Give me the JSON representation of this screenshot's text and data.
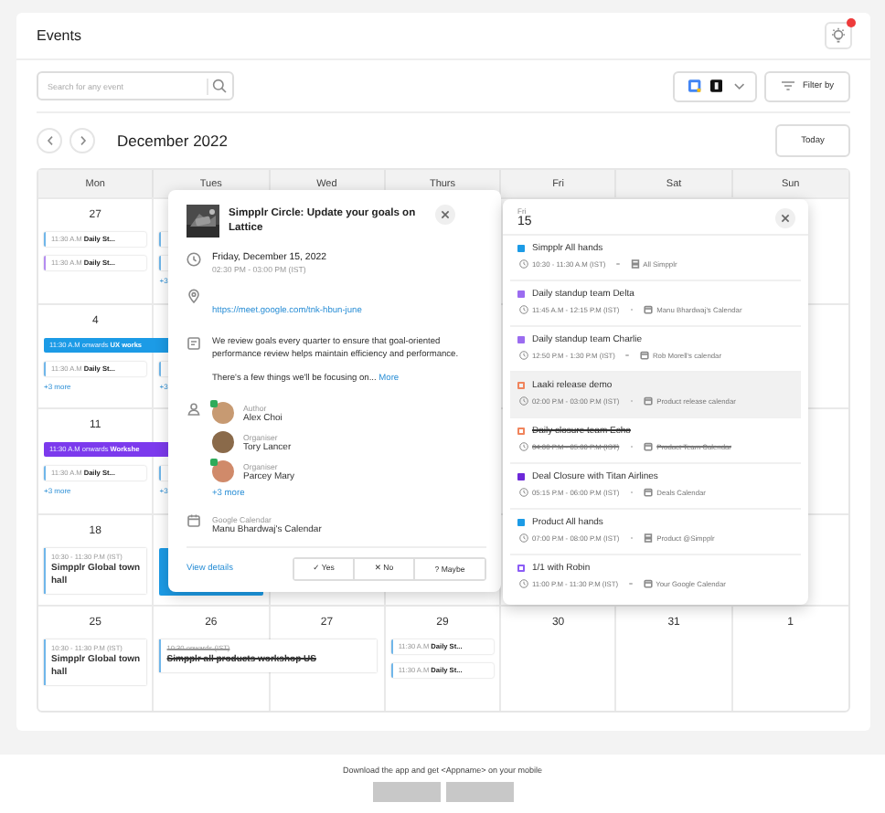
{
  "header": {
    "title": "Events",
    "notification": true
  },
  "search": {
    "placeholder": "Search for any event"
  },
  "calendar_toggle": {
    "sources": [
      {
        "kind": "google"
      },
      {
        "kind": "dark"
      }
    ]
  },
  "filter": {
    "label": "Filter by"
  },
  "nav": {
    "month": "December 2022",
    "today": "Today"
  },
  "weekdays": [
    "Mon",
    "Tues",
    "Wed",
    "Thurs",
    "Fri",
    "Sat",
    "Sun"
  ],
  "weeks": [
    {
      "cells": [
        {
          "date": "27",
          "events": [
            {
              "kind": "line",
              "time": "11:30 A.M",
              "title": "Daily St...",
              "color": "#6fb6ea"
            },
            {
              "kind": "line",
              "time": "11:30 A.M",
              "title": "Daily St...",
              "color": "#b48cf0"
            }
          ]
        },
        {
          "events": [
            {
              "kind": "stub",
              "color": "#6fb6ea"
            },
            {
              "kind": "stub",
              "color": "#6fb6ea"
            }
          ],
          "more": "+3"
        },
        {},
        {},
        {},
        {},
        {}
      ]
    },
    {
      "cells": [
        {
          "date": "4",
          "events": [
            {
              "kind": "banner",
              "time": "11:30 A.M onwards",
              "title": "UX works",
              "color": "#1c9be6"
            },
            {
              "kind": "line",
              "time": "11:30 A.M",
              "title": "Daily St...",
              "color": "#6fb6ea"
            }
          ],
          "more": "+3 more"
        },
        {
          "events": [
            {
              "kind": "stub",
              "color": "#6fb6ea"
            }
          ],
          "more": "+3"
        },
        {},
        {},
        {},
        {},
        {}
      ]
    },
    {
      "cells": [
        {
          "date": "11",
          "events": [
            {
              "kind": "banner",
              "time": "11:30 A.M onwards",
              "title": "Workshe",
              "color": "#7c3aed"
            },
            {
              "kind": "line",
              "time": "11:30 A.M",
              "title": "Daily St...",
              "color": "#6fb6ea"
            }
          ],
          "more": "+3 more"
        },
        {
          "events": [
            {
              "kind": "stub",
              "color": "#6fb6ea"
            }
          ],
          "more": "+3"
        },
        {},
        {},
        {},
        {},
        {}
      ]
    },
    {
      "cells": [
        {
          "date": "18",
          "events": [
            {
              "kind": "block",
              "time": "10:30 - 11:30 P.M (IST)",
              "title": "Simpplr Global town hall",
              "color": "#6fb6ea",
              "cancelled": false
            }
          ]
        },
        {
          "events": [
            {
              "kind": "fill",
              "color": "#1c9be6"
            }
          ]
        },
        {},
        {},
        {},
        {},
        {}
      ]
    },
    {
      "cells": [
        {
          "date": "25",
          "events": [
            {
              "kind": "block",
              "time": "10:30 - 11:30 P.M (IST)",
              "title": "Simpplr Global town hall",
              "color": "#6fb6ea",
              "cancelled": false
            }
          ]
        },
        {
          "date": "26",
          "events": [
            {
              "kind": "wide_block",
              "time": "10:30 onwards (IST)",
              "title": "Simpplr all products workshop US",
              "color": "#6fb6ea",
              "cancelled": true
            }
          ]
        },
        {
          "date": "27"
        },
        {
          "date": "29",
          "events": [
            {
              "kind": "line",
              "time": "11:30 A.M",
              "title": "Daily St...",
              "color": "#6fb6ea"
            },
            {
              "kind": "line",
              "time": "11:30 A.M",
              "title": "Daily St...",
              "color": "#6fb6ea"
            }
          ]
        },
        {
          "date": "30"
        },
        {
          "date": "31"
        },
        {
          "date": "1"
        }
      ]
    }
  ],
  "event_popover": {
    "title": "Simpplr Circle: Update your goals on Lattice",
    "date": "Friday, December 15, 2022",
    "time": "02:30 PM - 03:00 PM (IST)",
    "link": "https://meet.google.com/tnk-hbun-june",
    "description": "We review goals every quarter to ensure that goal-oriented performance review helps maintain efficiency and performance.",
    "teaser": "There's a few things we'll be focusing on...",
    "more": "More",
    "people": [
      {
        "role": "Author",
        "name": "Alex Choi",
        "badge": true
      },
      {
        "role": "Organiser",
        "name": "Tory Lancer",
        "badge": false
      },
      {
        "role": "Organiser",
        "name": "Parcey Mary",
        "badge": true
      }
    ],
    "people_more": "+3 more",
    "calendar_source": "Google Calendar",
    "calendar": "Manu Bhardwaj's Calendar",
    "details": "View details",
    "rsvp": [
      {
        "label": "✓ Yes",
        "selected": false
      },
      {
        "label": "✕ No",
        "selected": false
      },
      {
        "label": "? Maybe",
        "selected": false
      }
    ]
  },
  "day_popover": {
    "weekday": "Fri",
    "date": "15",
    "events": [
      {
        "title": "Simpplr All hands",
        "time": "10:30 - 11:30 A.M (IST)",
        "calendar": "All Simpplr",
        "kind": "group",
        "color": "#1c9be6",
        "filled": true,
        "selected": false,
        "cancelled": false
      },
      {
        "title": "Daily standup team Delta",
        "time": "11:45 A.M - 12:15 P.M (IST)",
        "calendar": "Manu Bhardwaj's Calendar",
        "kind": "calendar",
        "color": "#9b6cf0",
        "filled": true,
        "selected": false,
        "cancelled": false
      },
      {
        "title": "Daily standup team Charlie",
        "time": "12:50 P.M - 1:30 P.M (IST)",
        "calendar": "Rob Morell's calendar",
        "kind": "calendar",
        "color": "#9b6cf0",
        "filled": true,
        "selected": false,
        "cancelled": false
      },
      {
        "title": "Laaki release demo",
        "time": "02:00 P.M - 03:00 P.M (IST)",
        "calendar": "Product release calendar",
        "kind": "calendar",
        "color": "#f0845c",
        "filled": false,
        "selected": true,
        "cancelled": false
      },
      {
        "title": "Daily closure team Echo",
        "time": "04:00 P.M - 05:00 P.M (IST)",
        "calendar": "Product Team Calendar",
        "kind": "calendar",
        "color": "#f0845c",
        "filled": false,
        "selected": false,
        "cancelled": true
      },
      {
        "title": "Deal Closure with Titan Airlines",
        "time": "05:15 P.M - 06:00 P.M (IST)",
        "calendar": "Deals Calendar",
        "kind": "calendar",
        "color": "#6d28d9",
        "filled": true,
        "selected": false,
        "cancelled": false
      },
      {
        "title": "Product All hands",
        "time": "07:00 P.M - 08:00 P.M (IST)",
        "calendar": "Product @Simpplr",
        "kind": "group",
        "color": "#1c9be6",
        "filled": true,
        "selected": false,
        "cancelled": false
      },
      {
        "title": "1/1 with Robin",
        "time": "11:00 P.M - 11:30 P.M (IST)",
        "calendar": "Your Google Calendar",
        "kind": "calendar",
        "color": "#8b5cf6",
        "filled": false,
        "selected": false,
        "cancelled": false
      }
    ]
  },
  "footer": {
    "text": "Download the app and get <Appname> on your mobile",
    "badges": [
      {
        "kind": "placeholder"
      },
      {
        "kind": "placeholder"
      }
    ]
  }
}
